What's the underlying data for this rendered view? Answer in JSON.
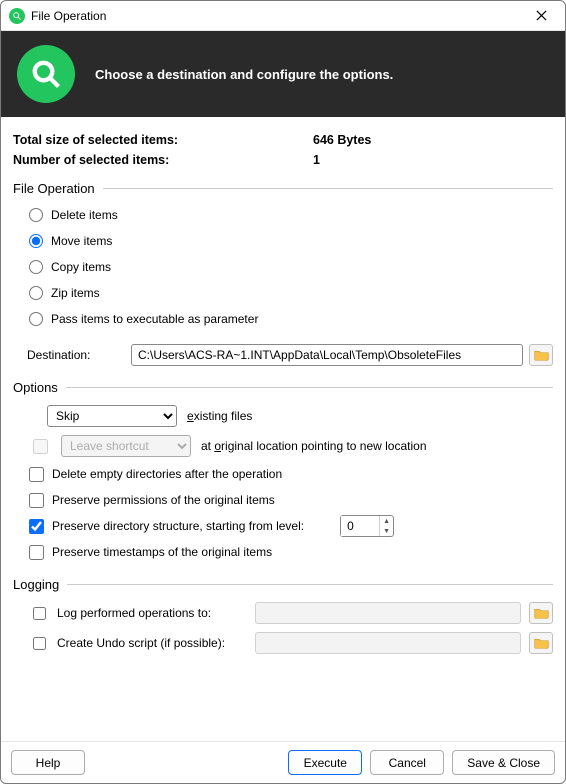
{
  "window": {
    "title": "File Operation"
  },
  "banner": {
    "text": "Choose a destination and configure the options."
  },
  "info": {
    "size_label": "Total size of selected items:",
    "size_value": "646 Bytes",
    "count_label": "Number of selected items:",
    "count_value": "1"
  },
  "file_op": {
    "legend": "File Operation",
    "selected": "move",
    "options": {
      "delete": "Delete items",
      "move": "Move items",
      "copy": "Copy items",
      "zip": "Zip items",
      "exec": "Pass items to executable as parameter"
    },
    "destination_label": "Destination:",
    "destination_value": "C:\\Users\\ACS-RA~1.INT\\AppData\\Local\\Temp\\ObsoleteFiles"
  },
  "options": {
    "legend": "Options",
    "existing_mode": "Skip",
    "existing_suffix": "xisting files",
    "existing_prefix": "e",
    "shortcut_label": "Leave shortcut",
    "shortcut_prefix": "at ",
    "shortcut_hot": "o",
    "shortcut_suffix": "riginal location pointing to new location",
    "shortcut_enabled": false,
    "delete_empty": "Delete empty directories after the operation",
    "delete_empty_checked": false,
    "preserve_perm": "Preserve permissions of the original items",
    "preserve_perm_checked": false,
    "preserve_struct": "Preserve directory structure, starting from level:",
    "preserve_struct_checked": true,
    "struct_level": "0",
    "preserve_ts": "Preserve timestamps of the original items",
    "preserve_ts_checked": false
  },
  "logging": {
    "legend": "Logging",
    "log_ops": "Log performed operations to:",
    "log_ops_checked": false,
    "log_ops_path": "",
    "undo": "Create Undo script (if possible):",
    "undo_checked": false,
    "undo_path": ""
  },
  "footer": {
    "help": "Help",
    "execute": "Execute",
    "cancel": "Cancel",
    "save": "Save & Close"
  }
}
